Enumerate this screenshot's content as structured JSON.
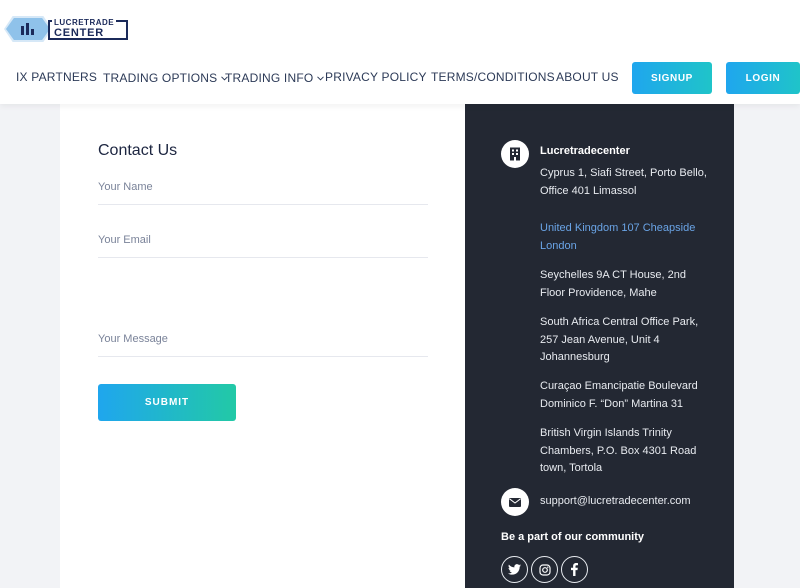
{
  "logo": {
    "top": "LUCRETRADE",
    "bottom": "CENTER"
  },
  "nav": {
    "items": [
      {
        "label": "IX PARTNERS"
      },
      {
        "label": "TRADING OPTIONS"
      },
      {
        "label": "TRADING INFO"
      },
      {
        "label": "PRIVACY POLICY"
      },
      {
        "label": "TERMS/CONDITIONS"
      },
      {
        "label": "ABOUT US"
      }
    ],
    "signup_label": "SIGNUP",
    "login_label": "LOGIN"
  },
  "form": {
    "title": "Contact Us",
    "name_placeholder": "Your Name",
    "email_placeholder": "Your Email",
    "message_placeholder": "Your Message",
    "submit_label": "SUBMIT"
  },
  "contact": {
    "company": "Lucretradecenter",
    "addresses": [
      "Cyprus 1, Siafi Street, Porto Bello, Office 401 Limassol",
      "United Kingdom 107 Cheapside London",
      "Seychelles 9A CT House, 2nd Floor Providence, Mahe",
      "South Africa Central Office Park, 257 Jean Avenue, Unit 4 Johannesburg",
      "Curaçao Emancipatie Boulevard Dominico F. “Don” Martina 31",
      "British Virgin Islands Trinity Chambers, P.O. Box 4301 Road town, Tortola"
    ],
    "email": "support@lucretradecenter.com",
    "community_heading": "Be a part of our community",
    "social_icons": [
      "twitter-icon",
      "instagram-icon",
      "facebook-icon"
    ]
  },
  "colors": {
    "accent_start": "#1fa6ee",
    "accent_end": "#22c9a6",
    "dark_panel": "#232833",
    "link_blue": "#6aa4e6"
  }
}
